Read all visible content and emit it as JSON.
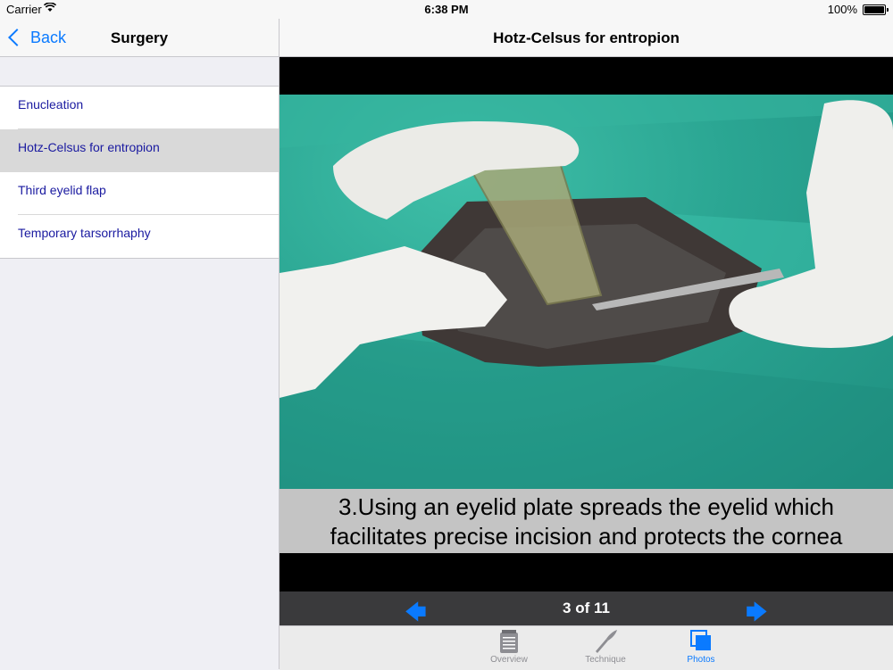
{
  "status_bar": {
    "carrier": "Carrier",
    "time": "6:38 PM",
    "battery": "100%"
  },
  "master": {
    "back_label": "Back",
    "title": "Surgery",
    "items": [
      {
        "label": "Enucleation"
      },
      {
        "label": "Hotz-Celsus for entropion",
        "selected": true
      },
      {
        "label": "Third eyelid flap"
      },
      {
        "label": "Temporary tarsorrhaphy"
      }
    ]
  },
  "detail": {
    "title": "Hotz-Celsus for entropion",
    "caption_line1": "3.Using an eyelid plate spreads the eyelid which",
    "caption_line2": "facilitates precise incision and protects the cornea",
    "pager": {
      "prev": "🡄",
      "count": "3 of 11",
      "next": "🡆"
    },
    "tabs": [
      {
        "label": "Overview",
        "icon": "notepad-icon"
      },
      {
        "label": "Technique",
        "icon": "scalpel-icon"
      },
      {
        "label": "Photos",
        "icon": "photos-icon",
        "active": true
      }
    ]
  },
  "colors": {
    "accent": "#0a7aff",
    "list_text": "#1a1aa0",
    "drape": "#2aa592",
    "pager_bg": "#3a3a3c"
  }
}
